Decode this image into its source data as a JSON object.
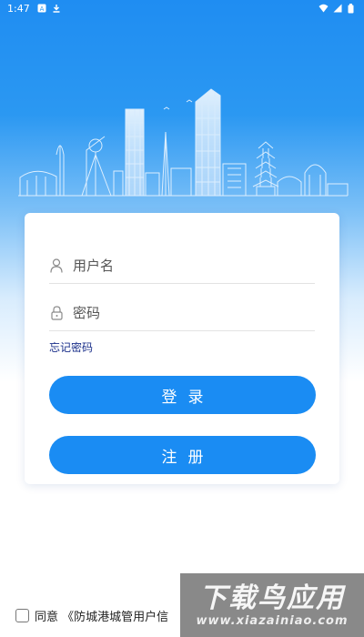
{
  "status_bar": {
    "time": "1:47",
    "left_icons": [
      "notification-a-icon",
      "download-icon"
    ],
    "right_icons": [
      "wifi-icon",
      "signal-icon",
      "battery-icon"
    ]
  },
  "header": {
    "illustration": "city-skyline-illustration"
  },
  "login_form": {
    "username_placeholder": "用户名",
    "password_placeholder": "密码",
    "forgot_password": "忘记密码",
    "login_button": "登录",
    "register_button": "注册"
  },
  "agreement": {
    "checked": false,
    "text": "同意 《防城港城管用户信"
  },
  "watermark": {
    "title": "下载鸟应用",
    "url": "www.xiazainiao.com"
  },
  "colors": {
    "primary": "#1a8cf3",
    "link": "#1a2f8a",
    "header_top": "#1f8df2"
  }
}
